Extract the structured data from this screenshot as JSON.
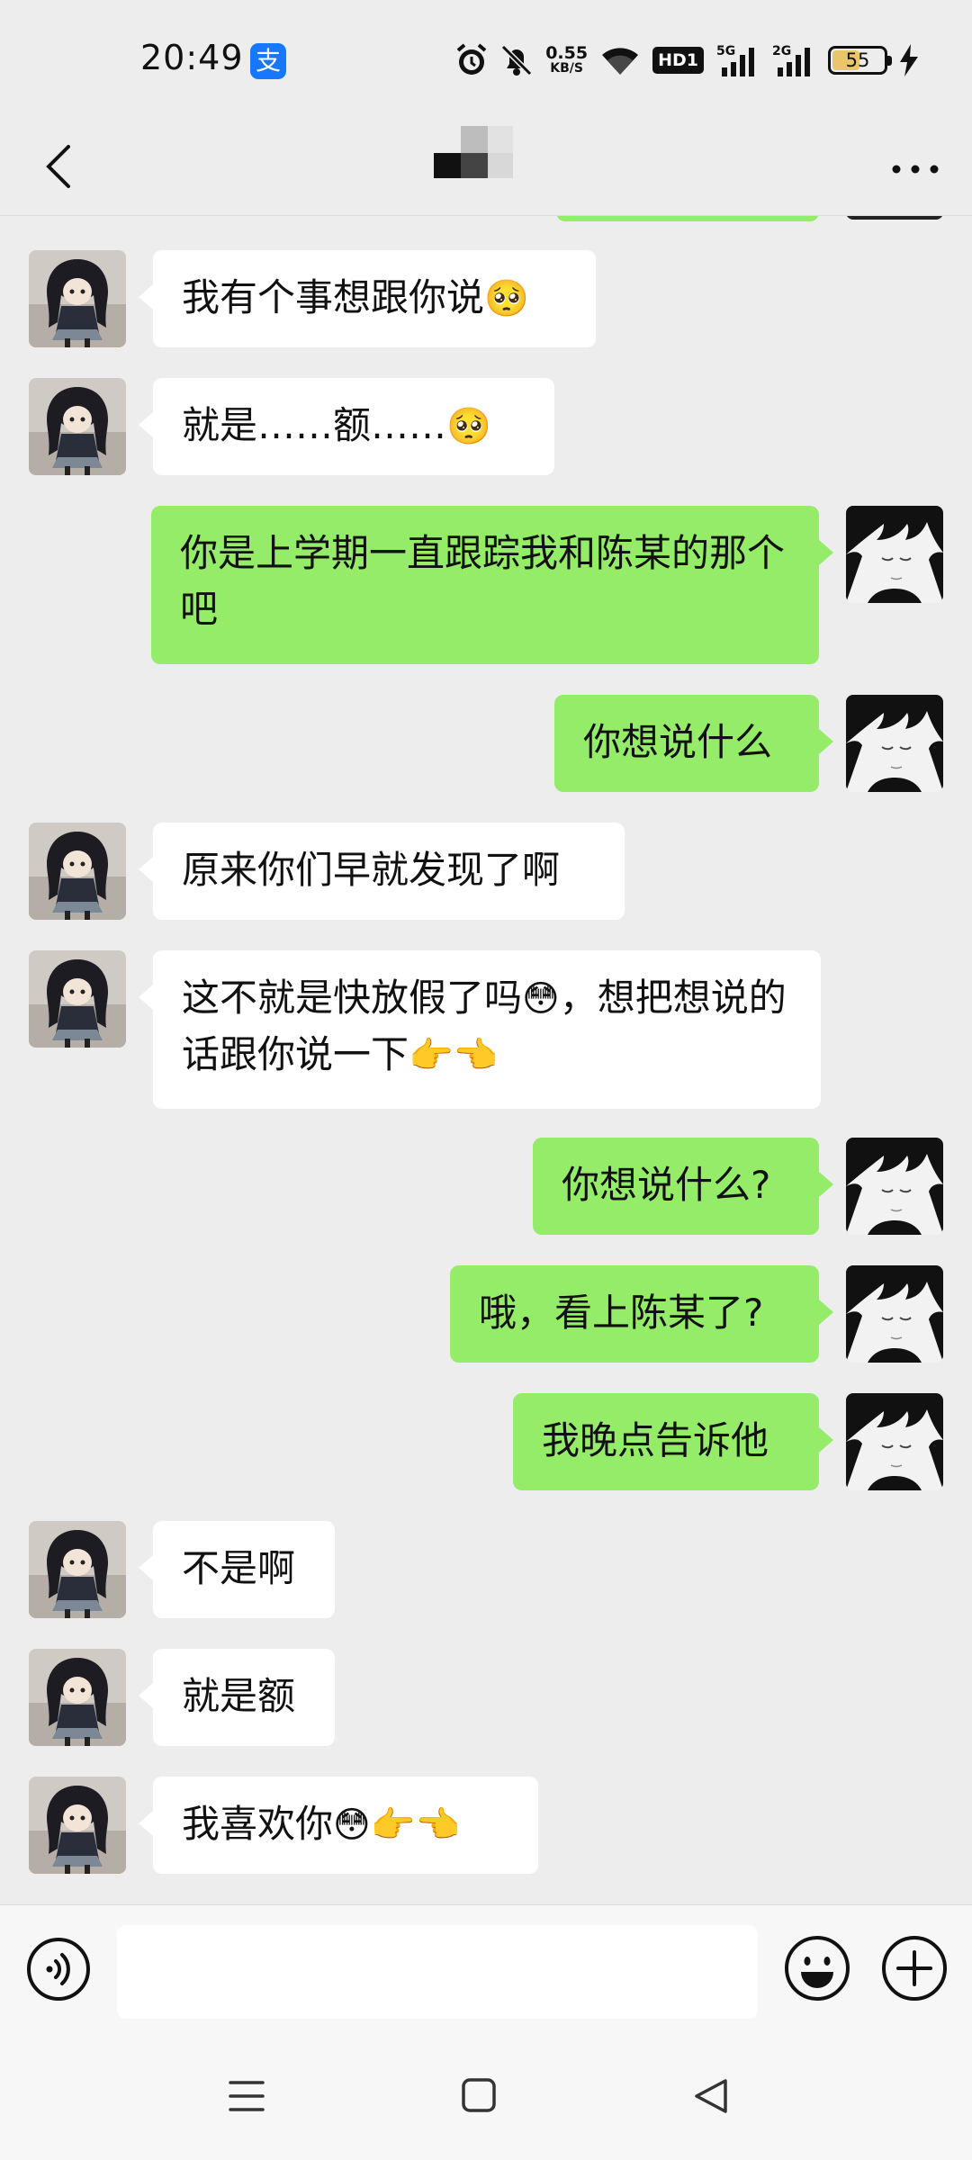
{
  "status_bar": {
    "time": "20:49",
    "alipay_glyph": "支",
    "net_speed_value": "0.55",
    "net_speed_unit": "KB/S",
    "hd_label": "HD1",
    "network_1": "5G",
    "network_2": "2G",
    "battery_level": "55",
    "battery_percent": 55,
    "icons": [
      "alarm-icon",
      "mute-icon",
      "wifi-icon",
      "signal-icon",
      "charging-icon"
    ]
  },
  "title_bar": {
    "back_icon": "chevron-left-icon",
    "more_icon": "more-dots-icon"
  },
  "messages": [
    {
      "side": "in",
      "parts": [
        "我有个事想跟你说",
        "🥺"
      ]
    },
    {
      "side": "in",
      "parts": [
        "就是……额……",
        "🥺"
      ]
    },
    {
      "side": "out",
      "parts": [
        "你是上学期一直跟踪我和陈某的那个吧"
      ]
    },
    {
      "side": "out",
      "parts": [
        "你想说什么"
      ]
    },
    {
      "side": "in",
      "parts": [
        "原来你们早就发现了啊"
      ]
    },
    {
      "side": "in",
      "parts": [
        "这不就是快放假了吗",
        "😳",
        "，想把想说的话跟你说一下",
        "👉👈"
      ]
    },
    {
      "side": "out",
      "parts": [
        "你想说什么?"
      ]
    },
    {
      "side": "out",
      "parts": [
        "哦，看上陈某了?"
      ]
    },
    {
      "side": "out",
      "parts": [
        "我晚点告诉他"
      ]
    },
    {
      "side": "in",
      "parts": [
        "不是啊"
      ]
    },
    {
      "side": "in",
      "parts": [
        "就是额"
      ]
    },
    {
      "side": "in",
      "parts": [
        "我喜欢你",
        "😳",
        "👉👈"
      ]
    }
  ],
  "input_bar": {
    "voice_icon": "voice-icon",
    "input_value": "",
    "emoji_icon": "smiley-icon",
    "plus_icon": "plus-circle-icon"
  },
  "nav_bar": {
    "icons": [
      "menu-icon",
      "home-square-icon",
      "back-triangle-icon"
    ]
  },
  "colors": {
    "background": "#ededed",
    "bubble_in": "#ffffff",
    "bubble_out": "#95ec69",
    "bar": "#f7f7f7"
  }
}
